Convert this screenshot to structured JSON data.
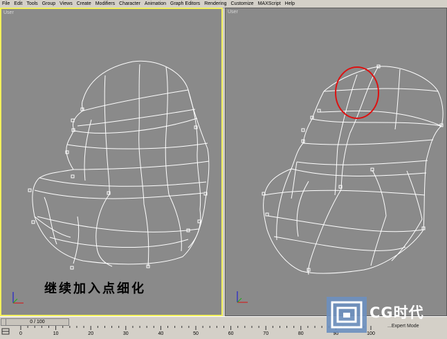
{
  "menu": [
    "File",
    "Edit",
    "Tools",
    "Group",
    "Views",
    "Create",
    "Modifiers",
    "Character",
    "Animation",
    "Graph Editors",
    "Rendering",
    "Customize",
    "MAXScript",
    "Help"
  ],
  "viewports": {
    "left_label": "User",
    "right_label": "User"
  },
  "caption": "继续加入点细化",
  "time_slider": {
    "label": "0 / 100"
  },
  "ruler_ticks": [
    "0",
    "10",
    "20",
    "30",
    "40",
    "50",
    "60",
    "70",
    "80",
    "90",
    "100"
  ],
  "logo": {
    "text": "CG时代"
  },
  "watermark": "...Expert Mode",
  "colors": {
    "wire": "#ffffff",
    "viewport_bg": "#8a8a8a",
    "active_border": "#f2f05a",
    "highlight_circle": "#dd1111"
  }
}
